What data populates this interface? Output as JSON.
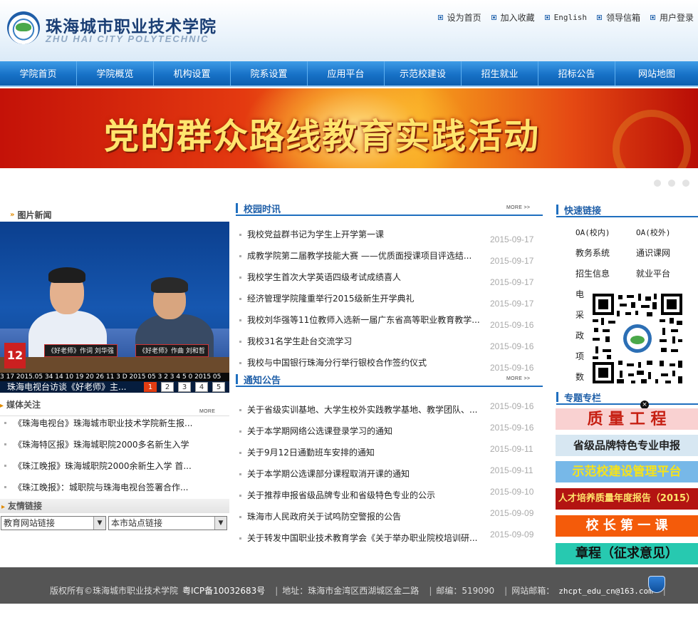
{
  "header": {
    "school_cn": "珠海城市职业技术学院",
    "school_en": "ZHU HAI CITY POLYTECHNIC",
    "top_links": [
      "设为首页",
      "加入收藏",
      "English",
      "领导信箱",
      "用户登录"
    ]
  },
  "nav": [
    "学院首页",
    "学院概览",
    "机构设置",
    "院系设置",
    "应用平台",
    "示范校建设",
    "招生就业",
    "招标公告",
    "网站地图"
  ],
  "banner": {
    "title": "党的群众路线教育实践活动"
  },
  "photo_news": {
    "title": "图片新闻",
    "caption": "珠海电视台访谈《好老师》主...",
    "nameplates": [
      "《好老师》作词 刘华强",
      "《好老师》作曲 刘和哲"
    ],
    "tv_logo": "12",
    "ticker": "3 17 2015.05 34 14 10 19 20 26 11 3 D 2015 05 3 2 3 4 5 0 2015 05",
    "pagers": [
      "1",
      "2",
      "3",
      "4",
      "5"
    ]
  },
  "media": {
    "title": "媒体关注",
    "more": "MORE",
    "items": [
      "《珠海电视台》珠海城市职业技术学院新生报...",
      "《珠海特区报》珠海城职院2000多名新生入学",
      "《珠江晚报》珠海城职院2000余新生入学 首...",
      "《珠江晚报》：城职院与珠海电视台签署合作..."
    ]
  },
  "friend_links": {
    "title": "友情链接",
    "select1": "教育网站链接",
    "select2": "本市站点链接"
  },
  "campus_news": {
    "title": "校园时讯",
    "more": "MORE >>",
    "items": [
      {
        "t": "我校党益群书记为学生上开学第一课",
        "d": "2015-09-17"
      },
      {
        "t": "成教学院第二届教学技能大赛 ——优质面授课项目评选结...",
        "d": "2015-09-17"
      },
      {
        "t": "我校学生首次大学英语四级考试成绩喜人",
        "d": "2015-09-17"
      },
      {
        "t": "经济管理学院隆重举行2015级新生开学典礼",
        "d": "2015-09-17"
      },
      {
        "t": "我校刘华强等11位教师入选新一届广东省高等职业教育教学...",
        "d": "2015-09-16"
      },
      {
        "t": "我校31名学生赴台交流学习",
        "d": "2015-09-16"
      },
      {
        "t": "我校与中国银行珠海分行举行银校合作签约仪式",
        "d": "2015-09-16"
      }
    ]
  },
  "notices": {
    "title": "通知公告",
    "more": "MORE >>",
    "items": [
      {
        "t": "关于省级实训基地、大学生校外实践教学基地、教学团队、...",
        "d": "2015-09-16"
      },
      {
        "t": "关于本学期网络公选课登录学习的通知",
        "d": "2015-09-16"
      },
      {
        "t": "关于9月12日通勤班车安排的通知",
        "d": "2015-09-11"
      },
      {
        "t": "关于本学期公选课部分课程取消开课的通知",
        "d": "2015-09-11"
      },
      {
        "t": "关于推荐申报省级品牌专业和省级特色专业的公示",
        "d": "2015-09-10"
      },
      {
        "t": "珠海市人民政府关于试鸣防空警报的公告",
        "d": "2015-09-09"
      },
      {
        "t": "关于转发中国职业技术教育学会《关于举办职业院校培训研...",
        "d": "2015-09-09"
      }
    ]
  },
  "quick_links": {
    "title": "快速链接",
    "items": [
      "OA(校内)",
      "OA(校外)",
      "教务系统",
      "通识课网",
      "招生信息",
      "就业平台"
    ],
    "vertical": [
      "电",
      "采",
      "政",
      "项",
      "数"
    ]
  },
  "special": {
    "title": "专题专栏",
    "items": [
      {
        "label": "质 量 工 程",
        "bg": "#f9d1d1",
        "fg": "#c61f12"
      },
      {
        "label": "省级品牌特色专业申报",
        "bg": "#d7e7f2",
        "fg": "#222222"
      },
      {
        "label": "示范校建设管理平台",
        "bg": "#77b8e8",
        "fg": "#f5e21b"
      },
      {
        "label": "人才培养质量年度报告（2015）",
        "bg": "#b31412",
        "fg": "#ffe36a"
      },
      {
        "label": "校 长 第 一 课",
        "bg": "#f45b0a",
        "fg": "#ffffff"
      },
      {
        "label": "章程（征求意见）",
        "bg": "#27c9b0",
        "fg": "#111111"
      }
    ]
  },
  "footer": {
    "copyright": "版权所有©珠海城市职业技术学院",
    "icp": "粤ICP备10032683号",
    "address": "地址：珠海市金湾区西湖城区金二路",
    "postcode": "邮编：519090",
    "email_label": "网站邮箱：",
    "email": "zhcpt_edu_cn@163.com"
  },
  "colors": {
    "nav": "#1771c7",
    "accent": "#1f6fbf",
    "footer": "#555555",
    "banner": "#d8260c"
  }
}
